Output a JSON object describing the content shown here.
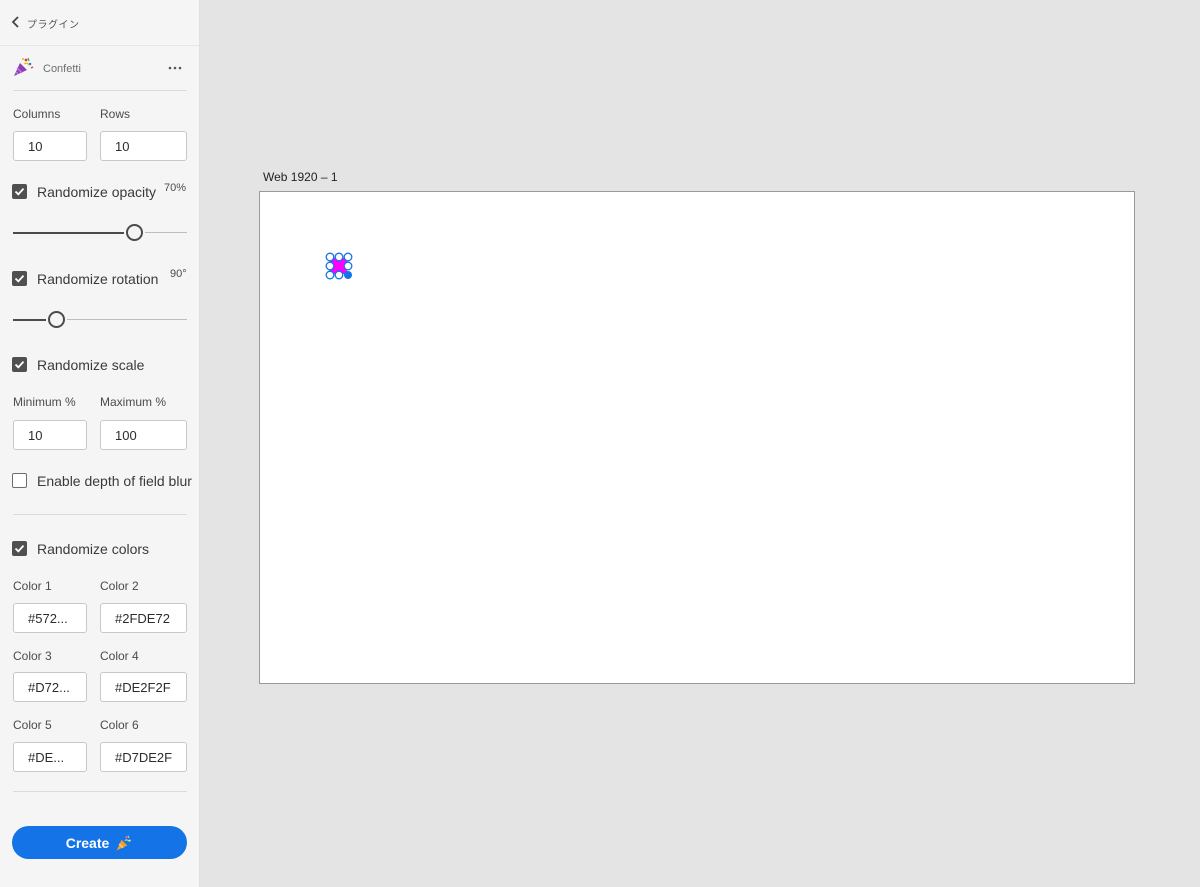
{
  "nav": {
    "back_label": "プラグイン"
  },
  "plugin": {
    "name": "Confetti",
    "icon": "party-popper-icon",
    "more_icon": "more-horizontal-icon"
  },
  "grid": {
    "columns_label": "Columns",
    "columns_value": "10",
    "rows_label": "Rows",
    "rows_value": "10"
  },
  "opacity": {
    "label": "Randomize opacity",
    "checked": true,
    "value_label": "70%",
    "level": 0.7
  },
  "rotation": {
    "label": "Randomize rotation",
    "checked": true,
    "value_label": "90°",
    "level": 0.25
  },
  "scale": {
    "label": "Randomize scale",
    "checked": true,
    "min_label": "Minimum %",
    "min_value": "10",
    "max_label": "Maximum %",
    "max_value": "100"
  },
  "depth": {
    "label": "Enable depth of field blur",
    "checked": false
  },
  "colors": {
    "label": "Randomize colors",
    "checked": true,
    "items": [
      {
        "label": "Color 1",
        "value": "#572..."
      },
      {
        "label": "Color 2",
        "value": "#2FDE72"
      },
      {
        "label": "Color 3",
        "value": "#D72..."
      },
      {
        "label": "Color 4",
        "value": "#DE2F2F"
      },
      {
        "label": "Color 5",
        "value": "#DE..."
      },
      {
        "label": "Color 6",
        "value": "#D7DE2F"
      }
    ]
  },
  "create": {
    "label": "Create",
    "accent": "#1473e6"
  },
  "canvas": {
    "artboard_title": "Web 1920 – 1",
    "selection_color": "#1473e6",
    "object_color": "#ff00ff"
  }
}
